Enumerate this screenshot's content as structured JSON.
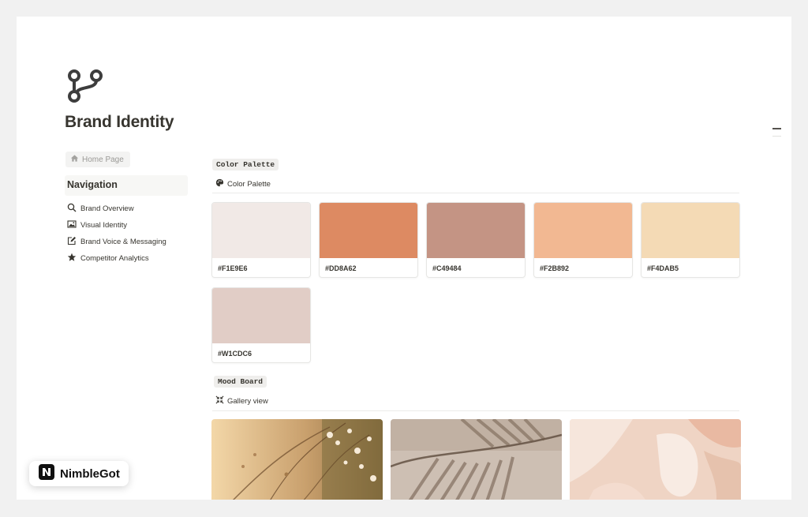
{
  "page": {
    "title": "Brand Identity",
    "icon": "branch-icon"
  },
  "sidebar": {
    "home_button": {
      "label": "Home Page",
      "icon": "home-icon"
    },
    "nav_heading": "Navigation",
    "items": [
      {
        "label": "Brand Overview",
        "icon": "search-icon"
      },
      {
        "label": "Visual Identity",
        "icon": "image-icon"
      },
      {
        "label": "Brand Voice & Messaging",
        "icon": "edit-icon"
      },
      {
        "label": "Competitor Analytics",
        "icon": "star-icon"
      }
    ]
  },
  "color_palette": {
    "heading": "Color Palette",
    "view_label": "Color Palette",
    "view_icon": "palette-icon",
    "swatches": [
      {
        "label": "#F1E9E6",
        "color": "#F1E9E6"
      },
      {
        "label": "#DD8A62",
        "color": "#DD8A62"
      },
      {
        "label": "#C49484",
        "color": "#C49484"
      },
      {
        "label": "#F2B892",
        "color": "#F2B892"
      },
      {
        "label": "#F4DAB5",
        "color": "#F4DAB5"
      },
      {
        "label": "#W1CDC6",
        "color": "#E1CDC6"
      }
    ]
  },
  "mood_board": {
    "heading": "Mood Board",
    "view_label": "Gallery view",
    "view_icon": "gallery-icon"
  },
  "watermark": {
    "text": "NimbleGot",
    "icon": "nimblegot-logo"
  }
}
